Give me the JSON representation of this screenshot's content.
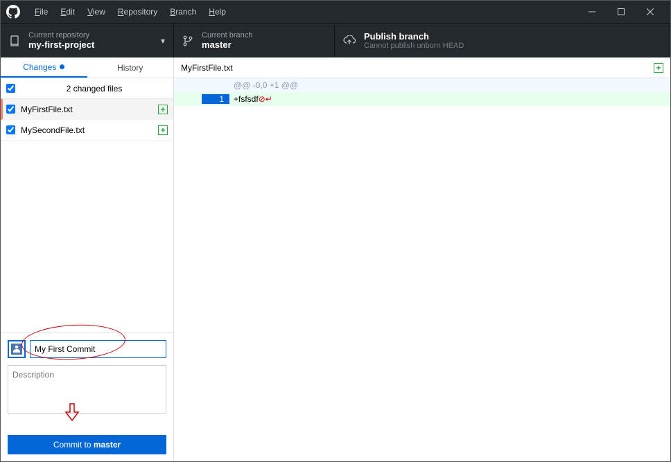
{
  "menu": {
    "file": "File",
    "edit": "Edit",
    "view": "View",
    "repository": "Repository",
    "branch": "Branch",
    "help": "Help"
  },
  "toolbar": {
    "repo": {
      "label": "Current repository",
      "value": "my-first-project"
    },
    "branch": {
      "label": "Current branch",
      "value": "master"
    },
    "publish": {
      "label": "Publish branch",
      "subtext": "Cannot publish unborn HEAD"
    }
  },
  "tabs": {
    "changes": "Changes",
    "history": "History"
  },
  "files": {
    "count_text": "2 changed files",
    "items": [
      {
        "name": "MyFirstFile.txt",
        "selected": true
      },
      {
        "name": "MySecondFile.txt",
        "selected": false
      }
    ]
  },
  "commit": {
    "summary_value": "My First Commit",
    "description_placeholder": "Description",
    "button_prefix": "Commit to ",
    "button_branch": "master"
  },
  "diff": {
    "filename": "MyFirstFile.txt",
    "hunk": "@@ -0,0 +1 @@",
    "line_number": "1",
    "added_prefix": "+",
    "added_text": "fsfsdf",
    "noeol_glyph": "⊘",
    "cr_glyph": "↵"
  }
}
